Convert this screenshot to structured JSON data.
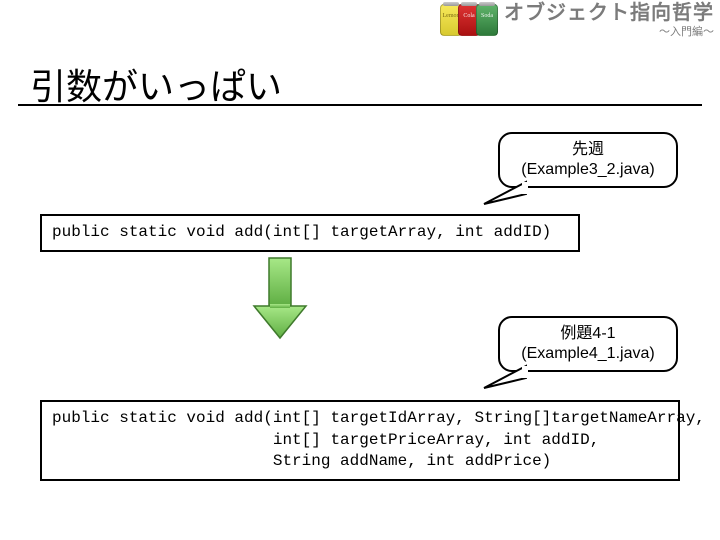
{
  "brand": {
    "main": "オブジェクト指向哲学",
    "sub": "～入門編～"
  },
  "cans": {
    "lemon": "Lemon",
    "cola": "Cola",
    "soda": "Soda"
  },
  "title": "引数がいっぱい",
  "callout1": {
    "line1": "先週",
    "line2": "(Example3_2.java)"
  },
  "callout2": {
    "line1": "例題4-1",
    "line2": "(Example4_1.java)"
  },
  "code1": "public static void add(int[] targetArray, int addID)",
  "code2": "public static void add(int[] targetIdArray, String[]targetNameArray,\n                       int[] targetPriceArray, int addID,\n                       String addName, int addPrice)"
}
